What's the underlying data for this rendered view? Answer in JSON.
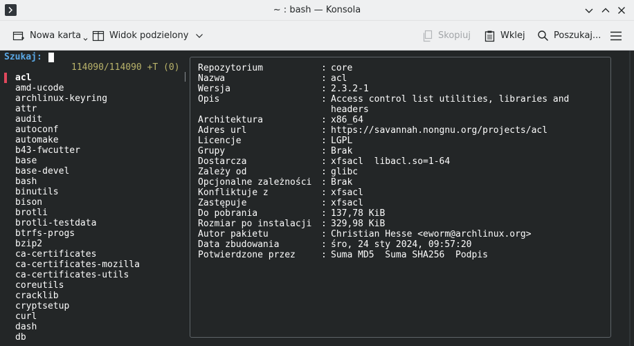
{
  "window": {
    "title": "~ : bash — Konsola"
  },
  "toolbar": {
    "new_tab": "Nowa karta",
    "split_view": "Widok podzielony",
    "copy": "Skopiuj",
    "paste": "Wklej",
    "find": "Poszukaj..."
  },
  "terminal": {
    "prompt": "Szukaj:",
    "counter": "114090/114090 +T (0)",
    "packages": [
      "acl",
      "amd-ucode",
      "archlinux-keyring",
      "attr",
      "audit",
      "autoconf",
      "automake",
      "b43-fwcutter",
      "base",
      "base-devel",
      "bash",
      "binutils",
      "bison",
      "brotli",
      "brotli-testdata",
      "btrfs-progs",
      "bzip2",
      "ca-certificates",
      "ca-certificates-mozilla",
      "ca-certificates-utils",
      "coreutils",
      "cracklib",
      "cryptsetup",
      "curl",
      "dash",
      "db"
    ],
    "selected_index": 0,
    "info_separator": ":",
    "info": [
      {
        "key": "Repozytorium",
        "value": "core"
      },
      {
        "key": "Nazwa",
        "value": "acl"
      },
      {
        "key": "Wersja",
        "value": "2.3.2-1"
      },
      {
        "key": "Opis",
        "value": "Access control list utilities, libraries and headers"
      },
      {
        "key": "Architektura",
        "value": "x86_64"
      },
      {
        "key": "Adres url",
        "value": "https://savannah.nongnu.org/projects/acl"
      },
      {
        "key": "Licencje",
        "value": "LGPL"
      },
      {
        "key": "Grupy",
        "value": "Brak"
      },
      {
        "key": "Dostarcza",
        "value": "xfsacl  libacl.so=1-64"
      },
      {
        "key": "Zależy od",
        "value": "glibc"
      },
      {
        "key": "Opcjonalne zależności",
        "value": "Brak"
      },
      {
        "key": "Konfliktuje z",
        "value": "xfsacl"
      },
      {
        "key": "Zastępuje",
        "value": "xfsacl"
      },
      {
        "key": "Do pobrania",
        "value": "137,78 KiB"
      },
      {
        "key": "Rozmiar po instalacji",
        "value": "329,98 KiB"
      },
      {
        "key": "Autor pakietu",
        "value": "Christian Hesse <eworm@archlinux.org>"
      },
      {
        "key": "Data zbudowania",
        "value": "śro, 24 sty 2024, 09:57:20"
      },
      {
        "key": "Potwierdzone przez",
        "value": "Suma MD5  Suma SHA256  Podpis"
      }
    ]
  },
  "colors": {
    "terminal_bg": "#232627",
    "terminal_fg": "#fcfcfc",
    "prompt": "#5aa8e6",
    "counter": "#b9b36a",
    "selection_marker": "#e0485c",
    "chrome_bg": "#eff0f1"
  },
  "icons": {
    "app": "konsole-terminal-icon",
    "new_tab": "new-tab-icon",
    "split_view": "split-view-icon",
    "copy": "copy-icon",
    "paste": "paste-icon",
    "find": "search-icon",
    "menu": "hamburger-menu-icon"
  }
}
